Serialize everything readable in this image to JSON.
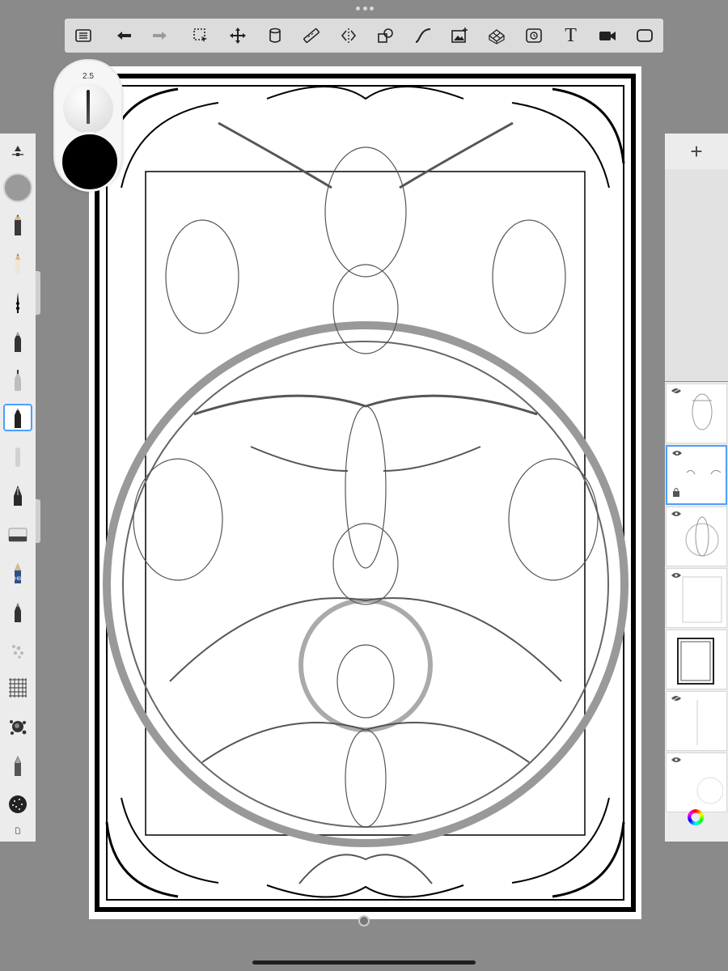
{
  "app": {
    "toolbar": {
      "buttons": [
        {
          "name": "layers-list-icon"
        },
        {
          "name": "undo-icon"
        },
        {
          "name": "redo-icon"
        },
        {
          "name": "selection-icon"
        },
        {
          "name": "transform-icon"
        },
        {
          "name": "fill-icon"
        },
        {
          "name": "ruler-icon"
        },
        {
          "name": "symmetry-icon"
        },
        {
          "name": "shape-icon"
        },
        {
          "name": "curve-icon"
        },
        {
          "name": "image-insert-icon"
        },
        {
          "name": "perspective-icon"
        },
        {
          "name": "timelapse-icon"
        },
        {
          "name": "text-icon",
          "label": "T"
        },
        {
          "name": "video-icon"
        },
        {
          "name": "fullscreen-icon"
        }
      ]
    },
    "brush": {
      "size": "2.5",
      "color": "#000000"
    },
    "left_tools": [
      {
        "name": "pencil-icon",
        "selected": false
      },
      {
        "name": "pencil-light-icon",
        "selected": false
      },
      {
        "name": "ink-brush-icon",
        "selected": false
      },
      {
        "name": "marker-icon",
        "selected": false
      },
      {
        "name": "technical-pen-icon",
        "selected": false
      },
      {
        "name": "fineliner-icon",
        "selected": true
      },
      {
        "name": "airbrush-icon",
        "selected": false
      },
      {
        "name": "fountain-pen-icon",
        "selected": false
      },
      {
        "name": "eraser-icon",
        "selected": false
      },
      {
        "name": "hb-pencil-icon",
        "selected": false,
        "label": "HB"
      },
      {
        "name": "paintbrush-icon",
        "selected": false
      },
      {
        "name": "texture-brush-icon",
        "selected": false
      },
      {
        "name": "grid-brush-icon",
        "selected": false
      },
      {
        "name": "splatter-brush-icon",
        "selected": false
      },
      {
        "name": "calligraphy-pen-icon",
        "selected": false
      },
      {
        "name": "noise-brush-icon",
        "selected": false
      }
    ],
    "layers": [
      {
        "visible": true,
        "selected": false
      },
      {
        "visible": true,
        "selected": true,
        "locked": true
      },
      {
        "visible": true,
        "selected": false
      },
      {
        "visible": true,
        "selected": false
      },
      {
        "visible": true,
        "selected": false
      },
      {
        "visible": true,
        "selected": false
      },
      {
        "visible": true,
        "selected": false
      }
    ],
    "add_layer_label": "+",
    "accent_color": "#4aa0ff"
  }
}
